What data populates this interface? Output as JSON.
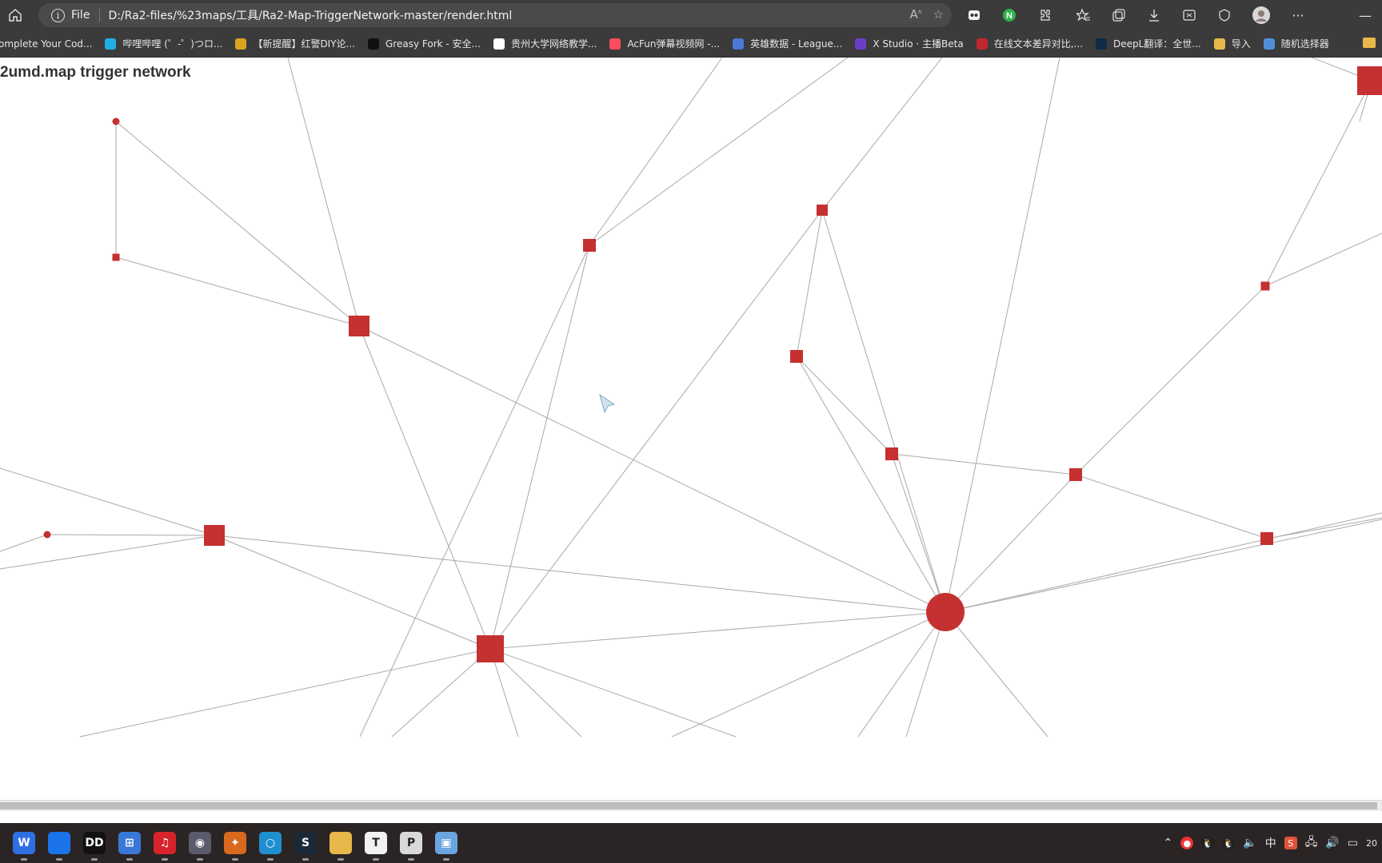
{
  "browser": {
    "scheme_label": "File",
    "url": "D:/Ra2-files/%23maps/工具/Ra2-Map-TriggerNetwork-master/render.html",
    "bookmarks": [
      {
        "label": "omplete Your Cod...",
        "color": "#3b3b3b"
      },
      {
        "label": "哔哩哔哩 (゜-゜)つロ...",
        "color": "#23ade5"
      },
      {
        "label": "【新提醒】红警DIY论...",
        "color": "#d9a521"
      },
      {
        "label": "Greasy Fork - 安全...",
        "color": "#111111"
      },
      {
        "label": "贵州大学网络教学...",
        "color": "#ffffff"
      },
      {
        "label": "AcFun弹幕视频网 -...",
        "color": "#fd4c5d"
      },
      {
        "label": "英雄数据 - League...",
        "color": "#4a78d6"
      },
      {
        "label": "X Studio · 主播Beta",
        "color": "#6a3ec7"
      },
      {
        "label": "在线文本差异对比,...",
        "color": "#c0262d"
      },
      {
        "label": "DeepL翻译：全世...",
        "color": "#0f2b46"
      },
      {
        "label": "导入",
        "color": "#e8b94a"
      },
      {
        "label": "随机选择器",
        "color": "#4f8fd9"
      }
    ],
    "toolbar_icons": [
      "home-icon",
      "read-aloud-icon",
      "favorite-add-icon",
      "extension-1-icon",
      "extension-2-icon",
      "extensions-icon",
      "favorites-icon",
      "collections-icon",
      "downloads-icon",
      "web-capture-icon",
      "browser-essentials-icon",
      "profile-avatar",
      "more-icon",
      "minimize-icon"
    ]
  },
  "page": {
    "title": "2umd.map trigger network"
  },
  "graph": {
    "node_color": "#c53030",
    "edge_color": "#a9a9a9",
    "nodes": [
      {
        "id": "a1",
        "shape": "circle"
      },
      {
        "id": "a2",
        "shape": "square"
      },
      {
        "id": "b",
        "shape": "square"
      },
      {
        "id": "c",
        "shape": "square"
      },
      {
        "id": "d",
        "shape": "square"
      },
      {
        "id": "e",
        "shape": "square"
      },
      {
        "id": "f",
        "shape": "square"
      },
      {
        "id": "g",
        "shape": "square"
      },
      {
        "id": "h",
        "shape": "square"
      },
      {
        "id": "i",
        "shape": "square"
      },
      {
        "id": "j",
        "shape": "circle"
      },
      {
        "id": "k",
        "shape": "square"
      },
      {
        "id": "hub",
        "shape": "circle"
      },
      {
        "id": "m",
        "shape": "square"
      },
      {
        "id": "n",
        "shape": "square"
      },
      {
        "id": "tr",
        "shape": "square"
      }
    ]
  },
  "taskbar": {
    "apps": [
      {
        "name": "wps-icon",
        "glyph": "W",
        "color": "#2f6fe4"
      },
      {
        "name": "chrome-icon",
        "glyph": "",
        "color": "#1a73e8"
      },
      {
        "name": "dolby-icon",
        "glyph": "DD",
        "color": "#111111"
      },
      {
        "name": "store-icon",
        "glyph": "⊞",
        "color": "#3a78d8"
      },
      {
        "name": "netease-music-icon",
        "glyph": "♫",
        "color": "#d7232b"
      },
      {
        "name": "game-app-icon",
        "glyph": "◉",
        "color": "#5a5a6a"
      },
      {
        "name": "red-alert-icon",
        "glyph": "✦",
        "color": "#d9691f"
      },
      {
        "name": "orb-app-icon",
        "glyph": "○",
        "color": "#1f8fd0"
      },
      {
        "name": "steam-icon",
        "glyph": "S",
        "color": "#1b2838"
      },
      {
        "name": "file-explorer-icon",
        "glyph": "",
        "color": "#e8b94a"
      },
      {
        "name": "typora-icon",
        "glyph": "T",
        "color": "#f2f2f2"
      },
      {
        "name": "presentation-icon",
        "glyph": "P",
        "color": "#d9d9d9"
      },
      {
        "name": "photos-icon",
        "glyph": "▣",
        "color": "#6aa5e0"
      }
    ],
    "ime_label": "中",
    "time_fragment": "20"
  }
}
